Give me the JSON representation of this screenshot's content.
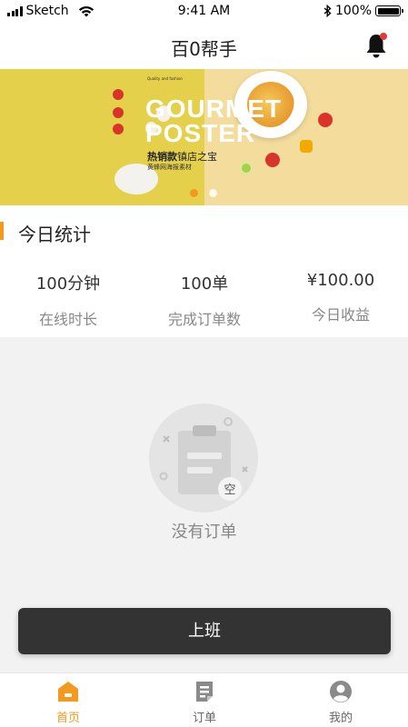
{
  "status_bar": {
    "carrier": "Sketch",
    "time": "9:41 AM",
    "battery": "100%"
  },
  "header": {
    "title": "百0帮手"
  },
  "banner": {
    "tagline": "Quality and fashion",
    "headline_line1": "GOURMET",
    "headline_line2": "POSTER",
    "sub_bold": "热销款",
    "sub_rest": "镇店之宝",
    "sub_small": "黄蜂网海报素材",
    "slide_count": 2,
    "active_slide": 1
  },
  "stats": {
    "heading": "今日统计",
    "items": [
      {
        "value": "100分钟",
        "label": "在线时长"
      },
      {
        "value": "100单",
        "label": "完成订单数"
      },
      {
        "value": "¥100.00",
        "label": "今日收益"
      }
    ]
  },
  "empty_state": {
    "badge": "空",
    "message": "没有订单"
  },
  "actions": {
    "on_duty_label": "上班"
  },
  "tabs": [
    {
      "label": "首页",
      "icon": "home-icon",
      "active": true
    },
    {
      "label": "订单",
      "icon": "order-icon",
      "active": false
    },
    {
      "label": "我的",
      "icon": "profile-icon",
      "active": false
    }
  ],
  "colors": {
    "accent": "#f39a1e",
    "button_bg": "#333333",
    "notification_dot": "#e53935"
  }
}
